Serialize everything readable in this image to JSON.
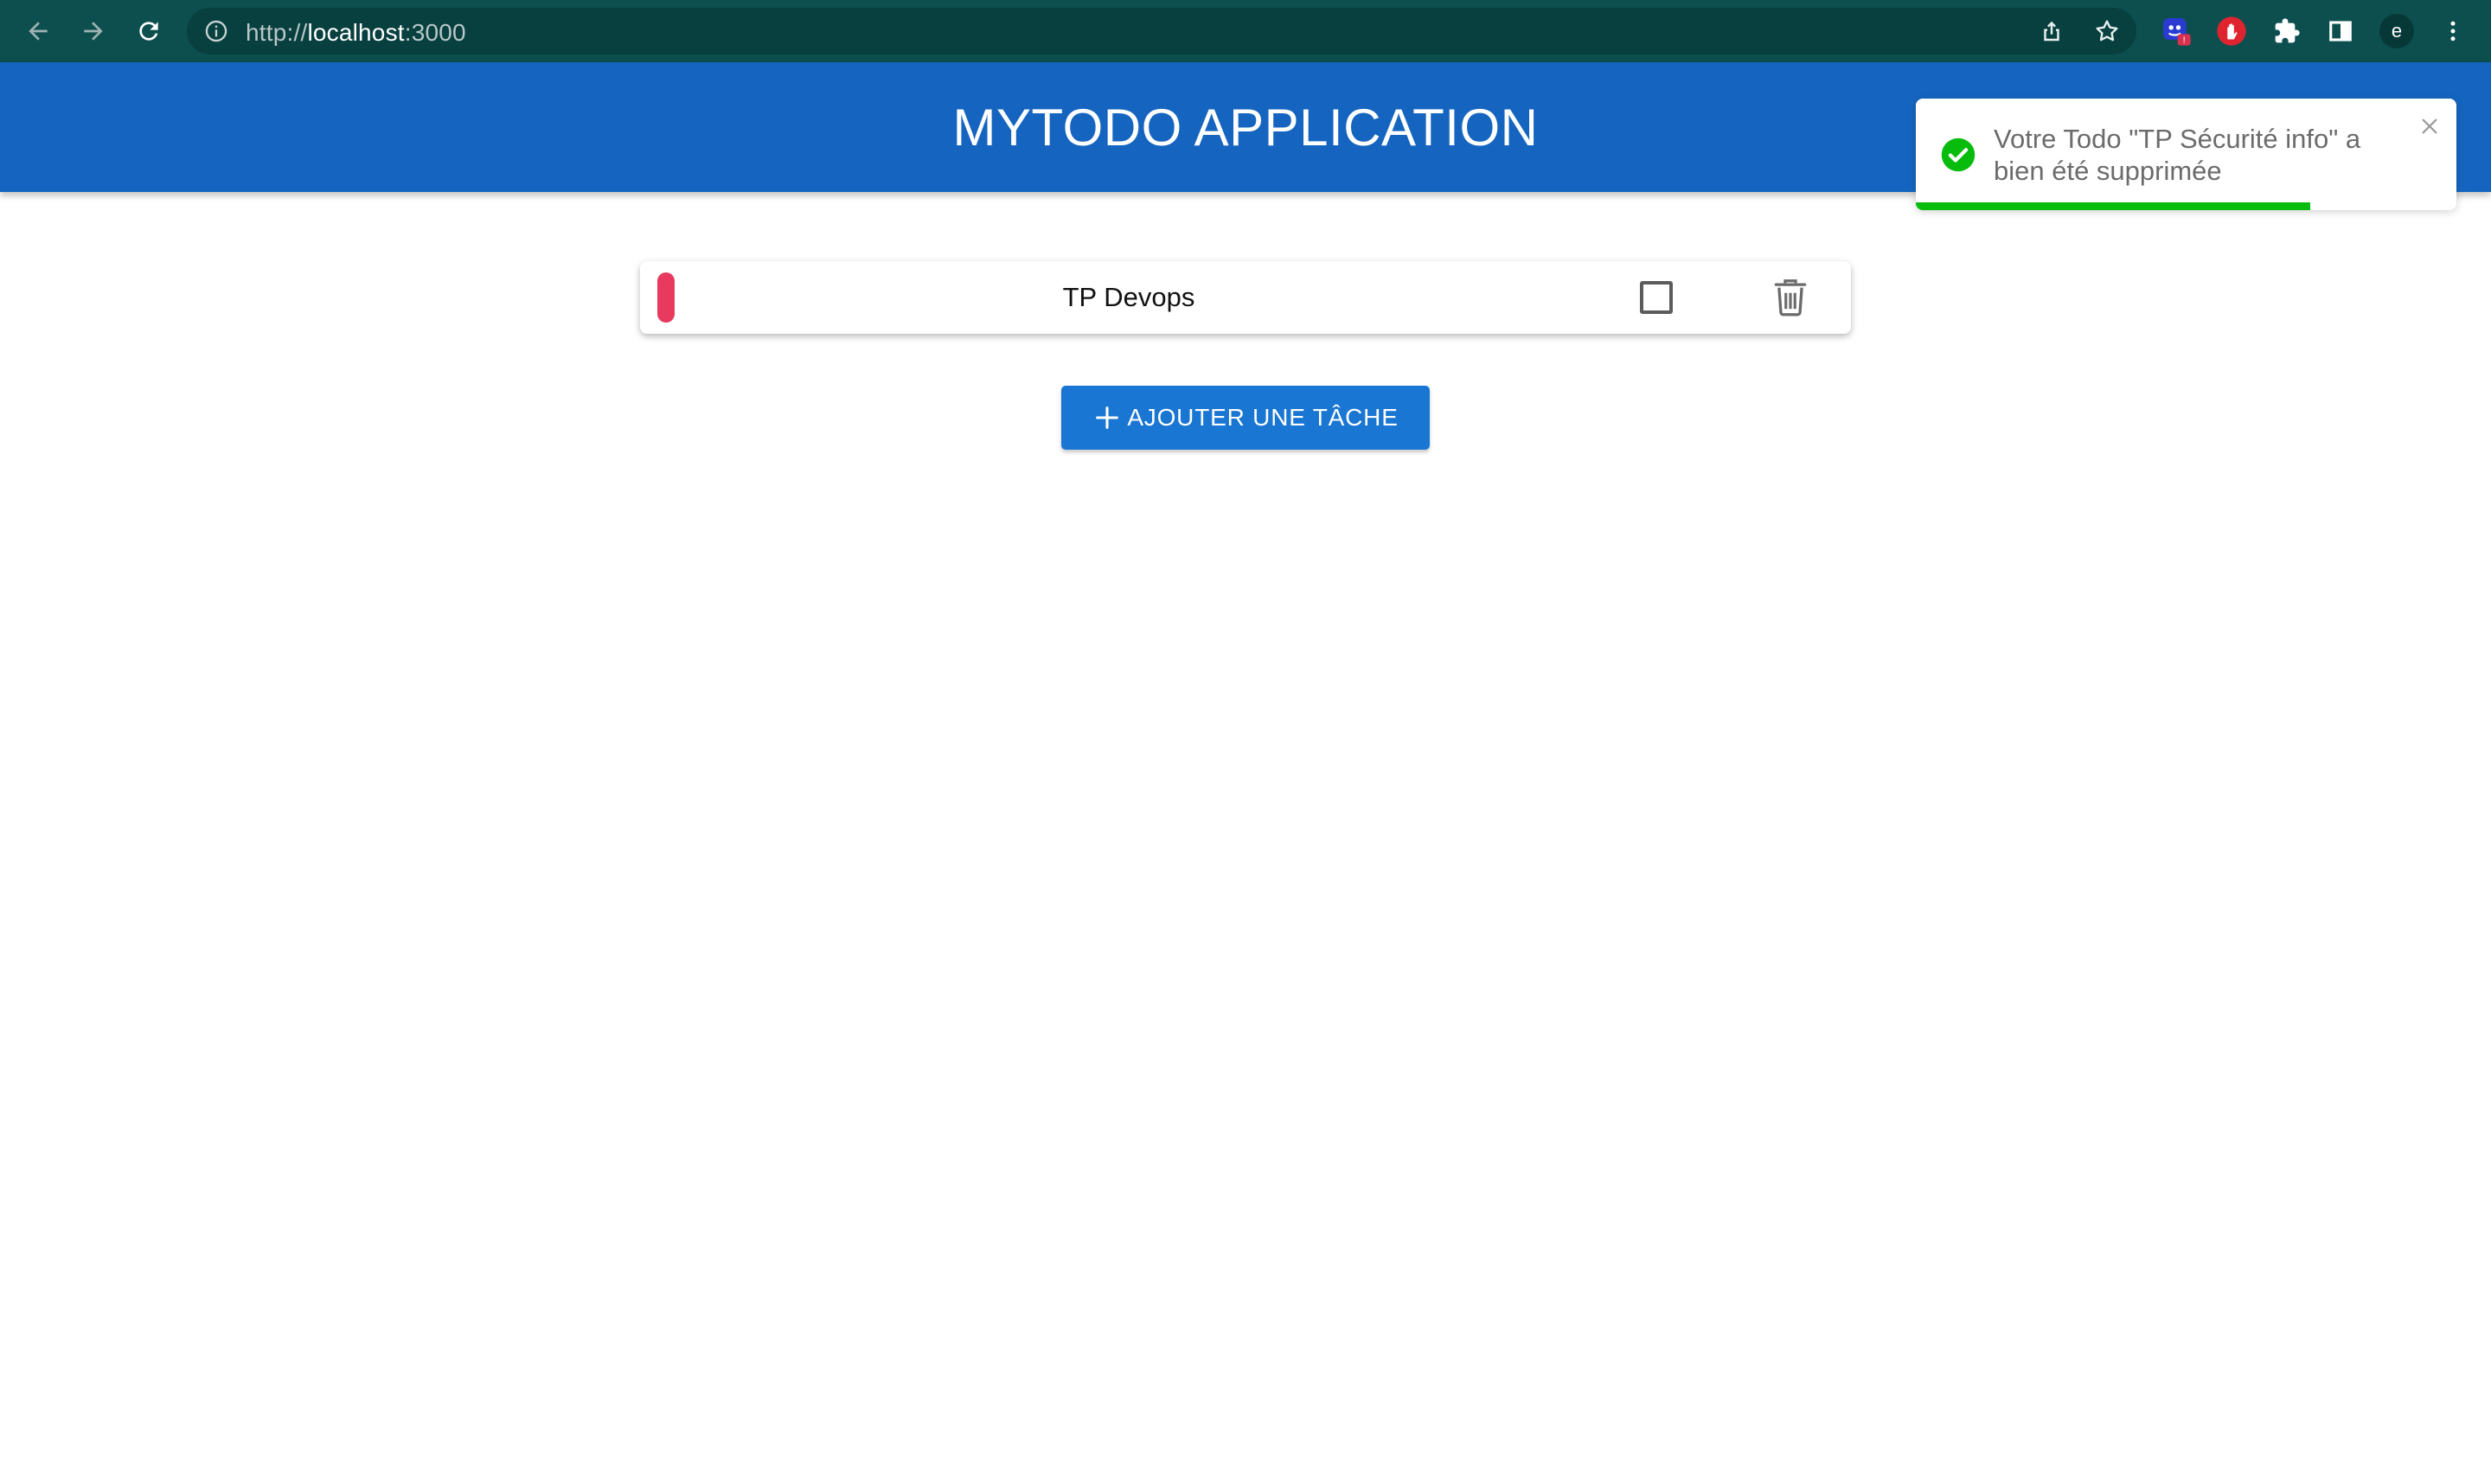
{
  "browser": {
    "url_scheme": "http://",
    "url_host": "localhost",
    "url_port": ":3000",
    "profile_initial": "e",
    "extension_badge": "!"
  },
  "app": {
    "title": "MYTODO APPLICATION"
  },
  "todos": [
    {
      "title": "TP Devops",
      "priority_color": "#e8395f",
      "done": false
    }
  ],
  "add_button": {
    "label": "AJOUTER UNE TÂCHE"
  },
  "toast": {
    "line1": "Votre Todo \"TP Sécurité info\" a",
    "line2": "bien été supprimée",
    "type": "success",
    "progress_fraction": 0.73
  },
  "colors": {
    "header": "#1565c0",
    "button": "#1976d2",
    "browser_bar": "#0d4f4f",
    "success": "#07bc0c"
  }
}
